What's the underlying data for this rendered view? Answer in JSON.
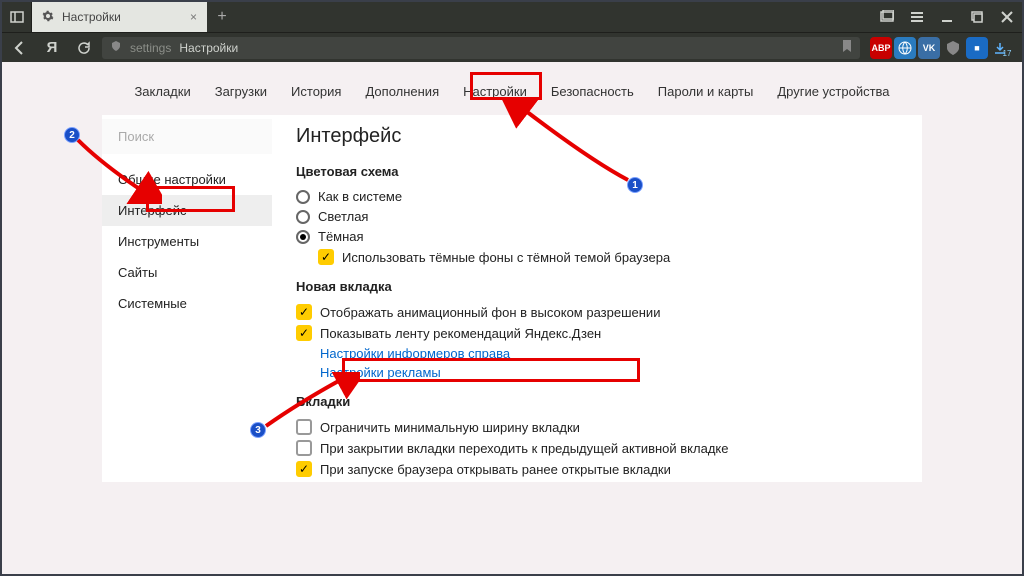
{
  "browser": {
    "tab_title": "Настройки",
    "addr_prefix": "settings",
    "addr_text": "Настройки",
    "download_count": "17"
  },
  "tabs": {
    "items": [
      "Закладки",
      "Загрузки",
      "История",
      "Дополнения",
      "Настройки",
      "Безопасность",
      "Пароли и карты",
      "Другие устройства"
    ],
    "active_index": 4
  },
  "sidebar": {
    "search": "Поиск",
    "items": [
      "Общие настройки",
      "Интерфейс",
      "Инструменты",
      "Сайты",
      "Системные"
    ],
    "active_index": 1
  },
  "pane": {
    "heading": "Интерфейс",
    "color_scheme": {
      "title": "Цветовая схема",
      "options": [
        "Как в системе",
        "Светлая",
        "Тёмная"
      ],
      "selected": 2,
      "dark_bg_checkbox": "Использовать тёмные фоны с тёмной темой браузера"
    },
    "new_tab": {
      "title": "Новая вкладка",
      "hi_res": "Отображать анимационный фон в высоком разрешении",
      "zen": "Показывать ленту рекомендаций Яндекс.Дзен",
      "link_informers": "Настройки информеров справа",
      "link_ads": "Настройки рекламы"
    },
    "tabs_section": {
      "title": "Вкладки",
      "min_width": "Ограничить минимальную ширину вкладки",
      "prev_active": "При закрытии вкладки переходить к предыдущей активной вкладке",
      "restore": "При запуске браузера открывать ранее открытые вкладки"
    }
  },
  "annotations": {
    "b1": "1",
    "b2": "2",
    "b3": "3"
  }
}
